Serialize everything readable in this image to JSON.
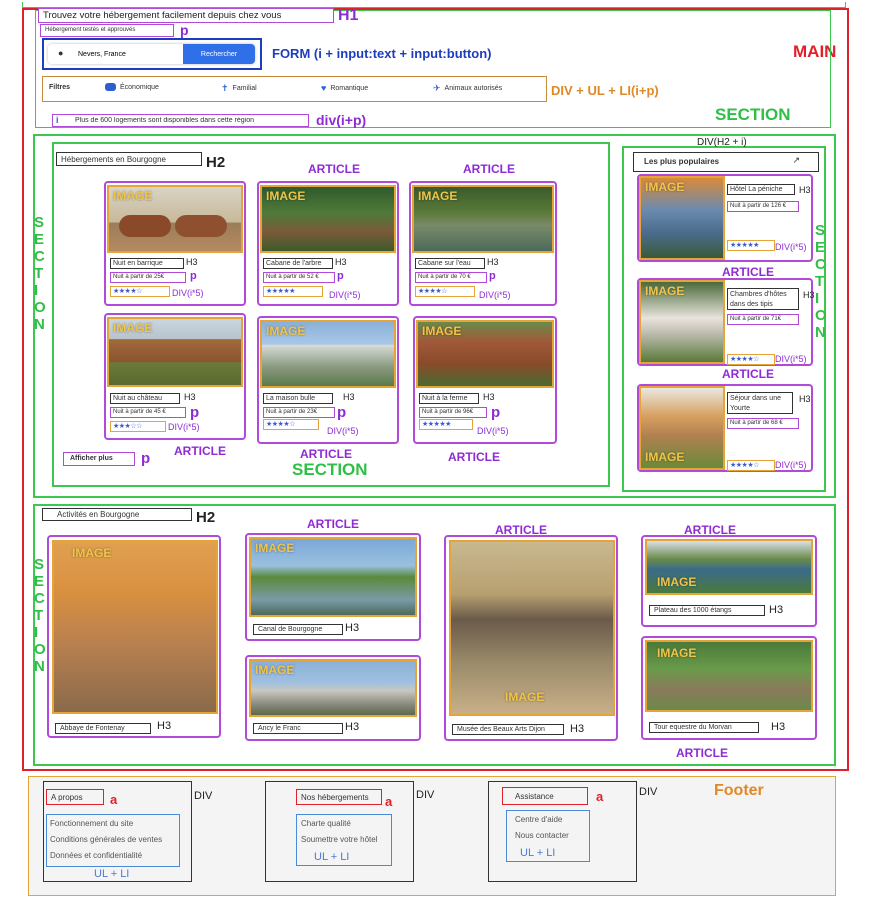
{
  "header": {
    "h1_text": "Trouvez votre hébergement facilement depuis chez vous",
    "h1_tag": "H1",
    "subtitle": "Hébergement testés et approuvés",
    "subtitle_tag": "p"
  },
  "main_label": "MAIN",
  "search": {
    "location": "Nevers, France",
    "button": "Rechercher",
    "label": "FORM (i + input:text + input:button)"
  },
  "filters": {
    "title": "Filtres",
    "items": [
      "Économique",
      "Familial",
      "Romantique",
      "Animaux autorisés"
    ],
    "label": "DIV + UL + LI(i+p)"
  },
  "section_label": "SECTION",
  "info": {
    "text": "Plus de 600 logements sont disponibles dans cette région",
    "label": "div(i+p)"
  },
  "stays": {
    "title": "Hébergements en Bourgogne",
    "title_tag": "H2",
    "cards": [
      {
        "name": "Nuit en barrique",
        "price": "Nuit à partir de 25€",
        "stars": "★★★★☆"
      },
      {
        "name": "Cabane de l'arbre",
        "price": "Nuit à partir de 52 €",
        "stars": "★★★★★"
      },
      {
        "name": "Cabane sur l'eau",
        "price": "Nuit à partir de 70 €",
        "stars": "★★★★☆"
      },
      {
        "name": "Nuit au château",
        "price": "Nuit à partir de 45 €",
        "stars": "★★★☆☆"
      },
      {
        "name": "La maison bulle",
        "price": "Nuit à partir de 23€",
        "stars": "★★★★☆"
      },
      {
        "name": "Nuit à la ferme",
        "price": "Nuit à partir de 96€",
        "stars": "★★★★★"
      }
    ],
    "more_button": "Afficher plus",
    "more_tag": "p"
  },
  "popular": {
    "header_label": "DIV(H2 + i)",
    "title": "Les plus populaires",
    "cards": [
      {
        "name": "Hôtel La péniche",
        "price": "Nuit à partir de 126 €",
        "stars": "★★★★★"
      },
      {
        "name": "Chambres d'hôtes dans des tipis",
        "price": "Nuit à partir de 71€",
        "stars": "★★★★☆"
      },
      {
        "name": "Séjour dans une Yourte",
        "price": "Nuit à partir de 68 €",
        "stars": "★★★★☆"
      }
    ]
  },
  "activities": {
    "title": "Activités en Bourgogne",
    "title_tag": "H2",
    "items": [
      {
        "name": "Abbaye de Fontenay"
      },
      {
        "name": "Canal de Bourgogne"
      },
      {
        "name": "Ancy le Franc"
      },
      {
        "name": "Musée des Beaux Arts Dijon"
      },
      {
        "name": "Plateau des 1000 étangs"
      },
      {
        "name": "Tour equestre du Morvan"
      }
    ]
  },
  "footer": {
    "label": "Footer",
    "columns": [
      {
        "title": "A propos",
        "links": [
          "Fonctionnement du site",
          "Conditions générales de ventes",
          "Données et confidentialité"
        ]
      },
      {
        "title": "Nos hébergements",
        "links": [
          "Charte qualité",
          "Soumettre votre hôtel"
        ]
      },
      {
        "title": "Assistance",
        "links": [
          "Centre d'aide",
          "Nous contacter"
        ]
      }
    ]
  },
  "annotations": {
    "article": "ARTICLE",
    "section": "SECTION",
    "image": "IMAGE",
    "h3": "H3",
    "p": "p",
    "stars_label": "DIV(i*5)",
    "div": "DIV",
    "a": "a",
    "ul_li": "UL + LI",
    "section_vertical": "SECTION"
  },
  "colors": {
    "annotation_purple": "#8e2bd6",
    "section_green": "#3cc84e",
    "main_red": "#e0202a",
    "image_orange": "#e6a338",
    "form_blue": "#1e3cbf",
    "button_blue": "#2f6fe8"
  }
}
